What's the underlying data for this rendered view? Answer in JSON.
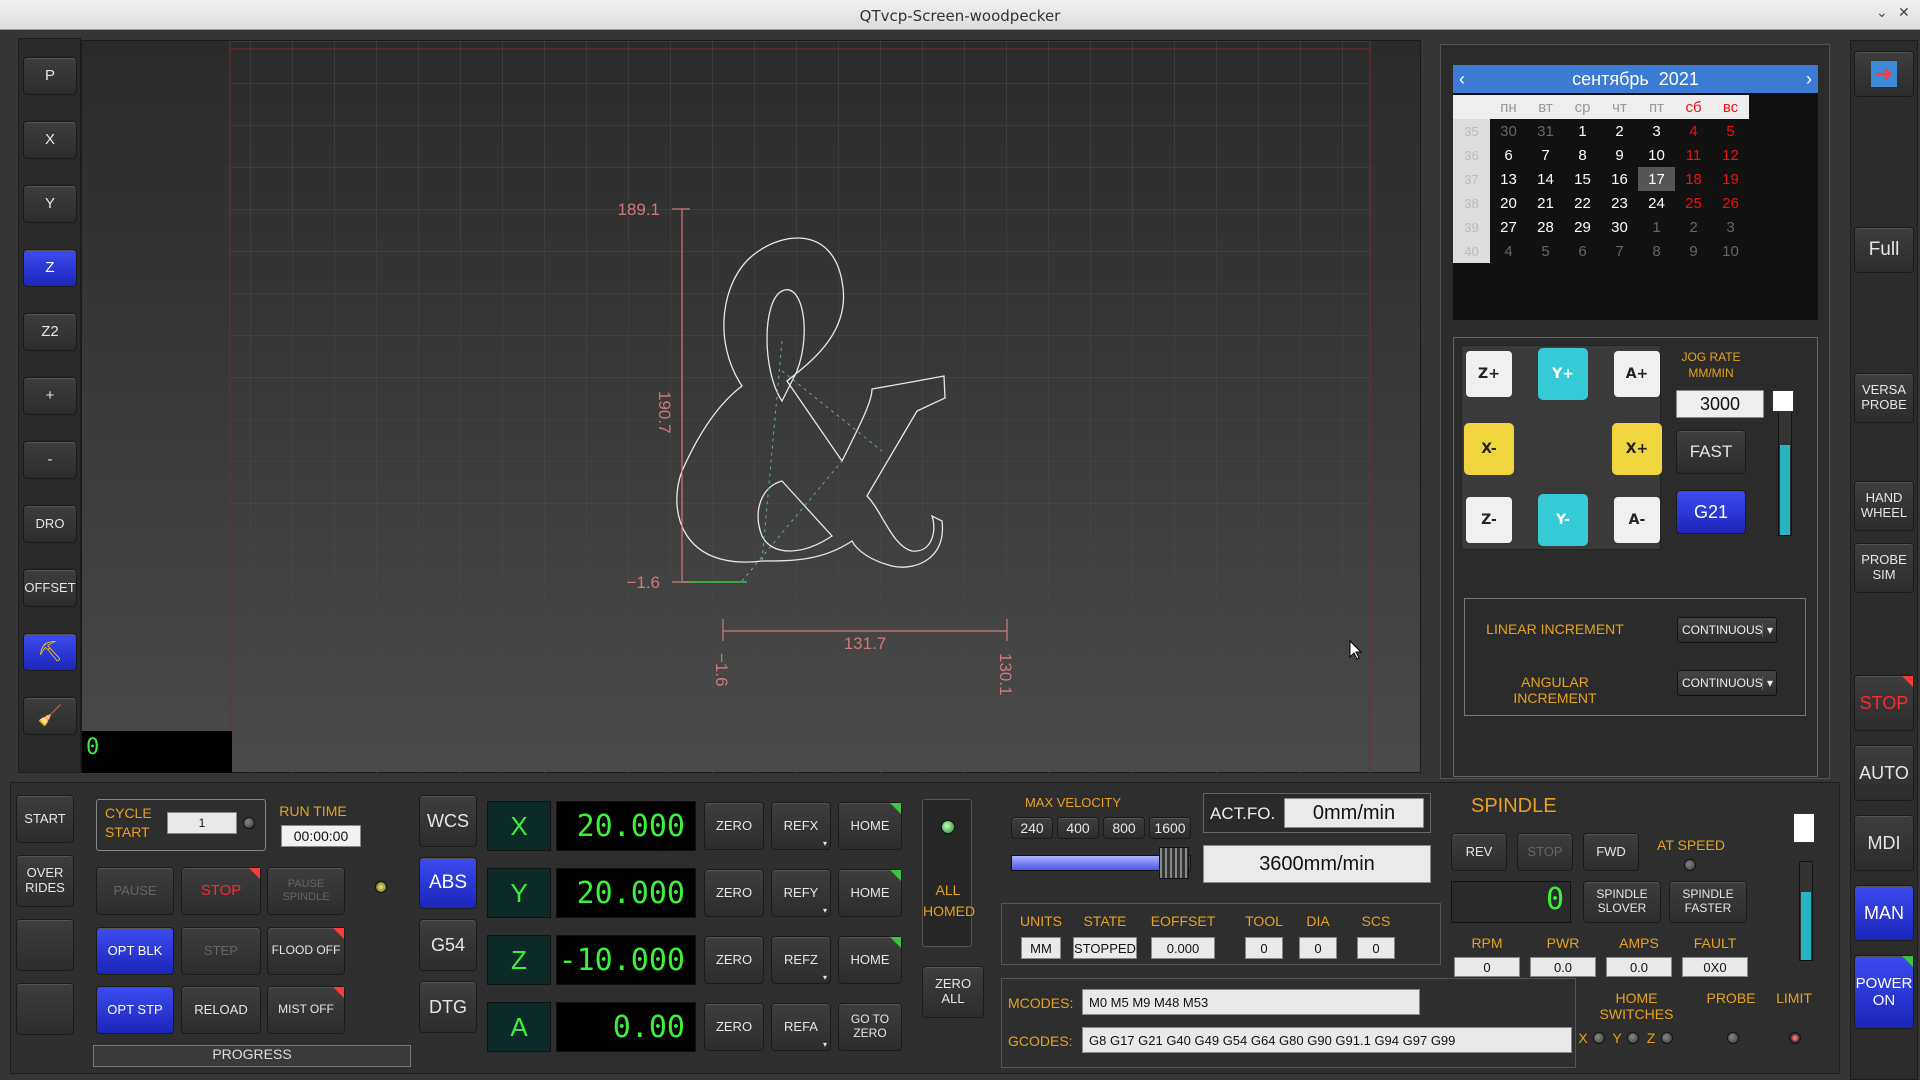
{
  "window": {
    "title": "QTvcp-Screen-woodpecker"
  },
  "left_toolbar": {
    "buttons": [
      "P",
      "X",
      "Y",
      "Z",
      "Z2",
      "+",
      "-",
      "DRO",
      "OFFSET"
    ]
  },
  "graphics": {
    "dims": {
      "top": "189.1",
      "bottom": "−1.6",
      "height": "190.7",
      "width": "131.7",
      "x_start": "−1.6",
      "x_end": "130.1"
    },
    "line_counter": "0"
  },
  "calendar": {
    "month": "сентябрь",
    "year": "2021",
    "weekdays": [
      "пн",
      "вт",
      "ср",
      "чт",
      "пт",
      "сб",
      "вс"
    ],
    "weeks": [
      [
        "35",
        "30",
        "31",
        "1",
        "2",
        "3",
        "4",
        "5"
      ],
      [
        "36",
        "6",
        "7",
        "8",
        "9",
        "10",
        "11",
        "12"
      ],
      [
        "37",
        "13",
        "14",
        "15",
        "16",
        "17",
        "18",
        "19"
      ],
      [
        "38",
        "20",
        "21",
        "22",
        "23",
        "24",
        "25",
        "26"
      ],
      [
        "39",
        "27",
        "28",
        "29",
        "30",
        "1",
        "2",
        "3"
      ],
      [
        "40",
        "4",
        "5",
        "6",
        "7",
        "8",
        "9",
        "10"
      ]
    ],
    "selected": "17"
  },
  "jog": {
    "buttons": [
      "Z+",
      "Y+",
      "A+",
      "X-",
      "X+",
      "Z-",
      "Y-",
      "A-"
    ],
    "rate_label": "JOG RATE MM/MIN",
    "rate": "3000",
    "fast": "FAST",
    "units_btn": "G21",
    "linear_label": "LINEAR INCREMENT",
    "linear_value": "CONTINUOUS",
    "angular_label": "ANGULAR INCREMENT",
    "angular_value": "CONTINUOUS"
  },
  "right_toolbar": {
    "full": "Full",
    "versa": "VERSA PROBE",
    "hand": "HAND WHEEL",
    "probe": "PROBE SIM",
    "stop": "STOP",
    "auto": "AUTO",
    "mdi": "MDI",
    "man": "MAN",
    "power": "POWER ON"
  },
  "bottom_left": {
    "start": "START",
    "overrides": "OVER RIDES"
  },
  "cycle": {
    "cycle_start": "CYCLE START",
    "count": "1",
    "run_time_label": "RUN TIME",
    "run_time": "00:00:00",
    "pause": "PAUSE",
    "stop": "STOP",
    "pause_spindle": "PAUSE SPINDLE",
    "opt_blk": "OPT BLK",
    "step": "STEP",
    "flood": "FLOOD OFF",
    "opt_stp": "OPT STP",
    "reload": "RELOAD",
    "mist": "MIST OFF",
    "progress": "PROGRESS"
  },
  "modes": {
    "wcs": "WCS",
    "abs": "ABS",
    "g54": "G54",
    "dtg": "DTG"
  },
  "dro": {
    "axes": [
      {
        "name": "X",
        "value": "20.000",
        "ref": "REFX",
        "home": "HOME"
      },
      {
        "name": "Y",
        "value": "20.000",
        "ref": "REFY",
        "home": "HOME"
      },
      {
        "name": "Z",
        "value": "-10.000",
        "ref": "REFZ",
        "home": "HOME"
      },
      {
        "name": "A",
        "value": "0.00",
        "ref": "REFA",
        "home": "GO TO ZERO"
      }
    ],
    "zero": "ZERO",
    "all_homed": "ALL HOMED",
    "zero_all": "ZERO ALL"
  },
  "velocity": {
    "label": "MAX VELOCITY",
    "presets": [
      "240",
      "400",
      "800",
      "1600"
    ],
    "act_fo_label": "ACT.FO.",
    "act_fo": "0mm/min",
    "max": "3600mm/min",
    "slider_fraction": 0.95
  },
  "status": {
    "headers": [
      "UNITS",
      "STATE",
      "EOFFSET",
      "TOOL",
      "DIA",
      "SCS"
    ],
    "values": [
      "MM",
      "STOPPED",
      "0.000",
      "0",
      "0",
      "0"
    ]
  },
  "codes": {
    "mcodes_label": "MCODES:",
    "mcodes": "M0 M5 M9 M48 M53",
    "gcodes_label": "GCODES:",
    "gcodes": "G8 G17 G21 G40 G49 G54 G64 G80 G90 G91.1 G94 G97 G99"
  },
  "spindle": {
    "title": "SPINDLE",
    "rev": "REV",
    "stop": "STOP",
    "fwd": "FWD",
    "at_speed": "AT SPEED",
    "speed": "0",
    "slower": "SPINDLE SLOVER",
    "faster": "SPINDLE FASTER",
    "headers": [
      "RPM",
      "PWR",
      "AMPS",
      "FAULT"
    ],
    "values": [
      "0",
      "0.0",
      "0.0",
      "0X0"
    ]
  },
  "switches": {
    "home_label": "HOME SWITCHES",
    "probe_label": "PROBE",
    "limit_label": "LIMIT",
    "axes": [
      "X",
      "Y",
      "Z"
    ]
  }
}
